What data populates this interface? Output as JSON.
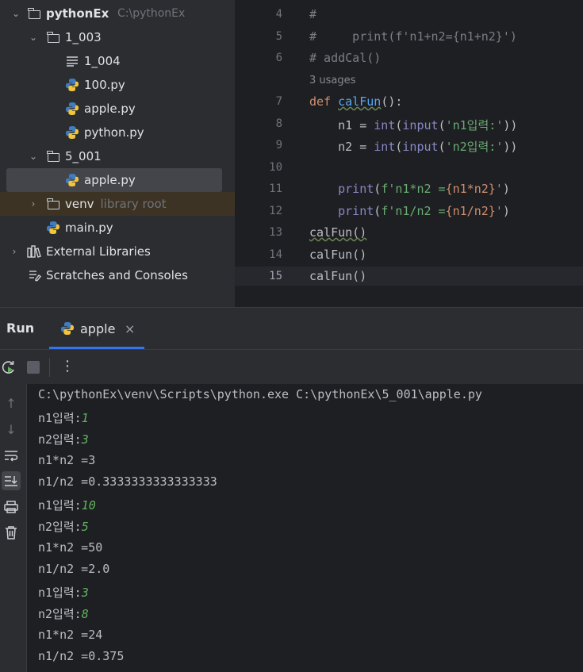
{
  "project_tree": {
    "root": {
      "name": "pythonEx",
      "path": "C:\\pythonEx"
    },
    "items": [
      {
        "label": "1_003",
        "type": "folder"
      },
      {
        "label": "1_004",
        "type": "text-file"
      },
      {
        "label": "100.py",
        "type": "python-file"
      },
      {
        "label": "apple.py",
        "type": "python-file"
      },
      {
        "label": "python.py",
        "type": "python-file"
      },
      {
        "label": "5_001",
        "type": "folder"
      },
      {
        "label": "apple.py",
        "type": "python-file",
        "selected": true
      },
      {
        "label": "venv",
        "hint": "library root",
        "type": "folder"
      },
      {
        "label": "main.py",
        "type": "python-file"
      },
      {
        "label": "External Libraries",
        "type": "libraries"
      },
      {
        "label": "Scratches and Consoles",
        "type": "scratches"
      }
    ]
  },
  "editor": {
    "line_numbers": [
      "4",
      "5",
      "6",
      "7",
      "8",
      "9",
      "10",
      "11",
      "12",
      "13",
      "14",
      "15"
    ],
    "current_line": "15",
    "usages_hint": "3 usages",
    "lines": {
      "l4": "#",
      "l5": "#     print(f'n1+n2={n1+n2}')",
      "l6": "# addCal()",
      "l7_kw": "def",
      "l7_fn": "calFun",
      "l7_rest": "():",
      "l8_a": "    n1 = ",
      "l8_int": "int",
      "l8_b": "(",
      "l8_input": "input",
      "l8_c": "(",
      "l8_str": "'n1입력:'",
      "l8_d": "))",
      "l9_a": "    n2 = ",
      "l9_int": "int",
      "l9_b": "(",
      "l9_input": "input",
      "l9_c": "(",
      "l9_str": "'n2입력:'",
      "l9_d": "))",
      "l11_a": "    ",
      "l11_print": "print",
      "l11_b": "(",
      "l11_str": "f'n1*n2 =",
      "l11_expr": "{n1*n2}",
      "l11_end": "'",
      "l11_close": ")",
      "l12_a": "    ",
      "l12_print": "print",
      "l12_b": "(",
      "l12_str": "f'n1/n2 =",
      "l12_expr": "{n1/n2}",
      "l12_end": "'",
      "l12_close": ")",
      "l13": "calFun()",
      "l14": "calFun()",
      "l15": "calFun()"
    }
  },
  "run_panel": {
    "title": "Run",
    "tab_label": "apple",
    "tab_close": "×",
    "toolbar": {
      "rerun": "rerun",
      "stop": "stop",
      "more": "⋮"
    },
    "console": [
      {
        "text": "C:\\pythonEx\\venv\\Scripts\\python.exe C:\\pythonEx\\5_001\\apple.py",
        "input": ""
      },
      {
        "text": "n1입력:",
        "input": "1"
      },
      {
        "text": "n2입력:",
        "input": "3"
      },
      {
        "text": "n1*n2 =3",
        "input": ""
      },
      {
        "text": "n1/n2 =0.3333333333333333",
        "input": ""
      },
      {
        "text": "n1입력:",
        "input": "10"
      },
      {
        "text": "n2입력:",
        "input": "5"
      },
      {
        "text": "n1*n2 =50",
        "input": ""
      },
      {
        "text": "n1/n2 =2.0",
        "input": ""
      },
      {
        "text": "n1입력:",
        "input": "3"
      },
      {
        "text": "n2입력:",
        "input": "8"
      },
      {
        "text": "n1*n2 =24",
        "input": ""
      },
      {
        "text": "n1/n2 =0.375",
        "input": ""
      }
    ]
  },
  "colors": {
    "background": "#1e1f22",
    "panel": "#2b2d30",
    "keyword": "#cf8e6d",
    "function": "#56a8f5",
    "string": "#6aab73",
    "comment": "#7a7e85",
    "console_input": "#5fb35f",
    "selection": "#43454a",
    "accent": "#3574f0"
  }
}
